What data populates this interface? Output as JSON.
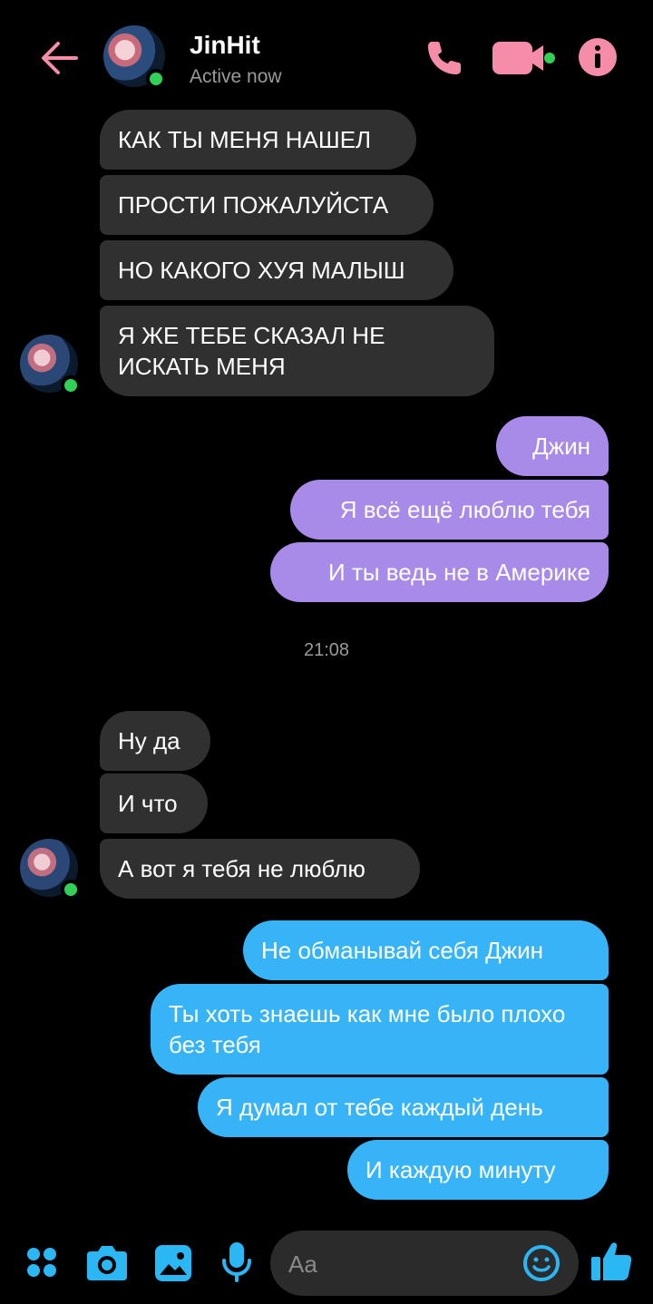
{
  "header": {
    "title": "JinHit",
    "status": "Active now",
    "accent_color": "#f58ca8"
  },
  "messages_group1": [
    {
      "text": "КАК ТЫ МЕНЯ НАШЕЛ"
    },
    {
      "text": "ПРОСТИ ПОЖАЛУЙСТА"
    },
    {
      "text": "НО КАКОГО ХУЯ МАЛЫШ"
    },
    {
      "text": " Я ЖЕ ТЕБЕ СКАЗАЛ НЕ ИСКАТЬ МЕНЯ"
    }
  ],
  "messages_group2": [
    {
      "text": "Джин"
    },
    {
      "text": "Я всё ещё люблю тебя"
    },
    {
      "text": "И ты ведь не в Америке"
    }
  ],
  "timestamp": "21:08",
  "messages_group3": [
    {
      "text": "Ну да"
    },
    {
      "text": "И что"
    },
    {
      "text": "А вот я тебя не люблю"
    }
  ],
  "messages_group4": [
    {
      "text": "Не обманывай себя Джин"
    },
    {
      "text": "Ты хоть знаешь как мне было плохо без тебя"
    },
    {
      "text": "Я думал от тебе каждый день"
    },
    {
      "text": "И каждую минуту"
    }
  ],
  "composer": {
    "placeholder": "Aa",
    "icon_color": "#2bb6f4"
  },
  "icons": {
    "back": "back-arrow-icon",
    "call": "phone-icon",
    "video": "video-camera-icon",
    "info": "info-icon",
    "menu": "four-dots-icon",
    "camera": "camera-icon",
    "gallery": "image-icon",
    "mic": "microphone-icon",
    "emoji": "smiley-icon",
    "like": "thumbs-up-icon"
  }
}
